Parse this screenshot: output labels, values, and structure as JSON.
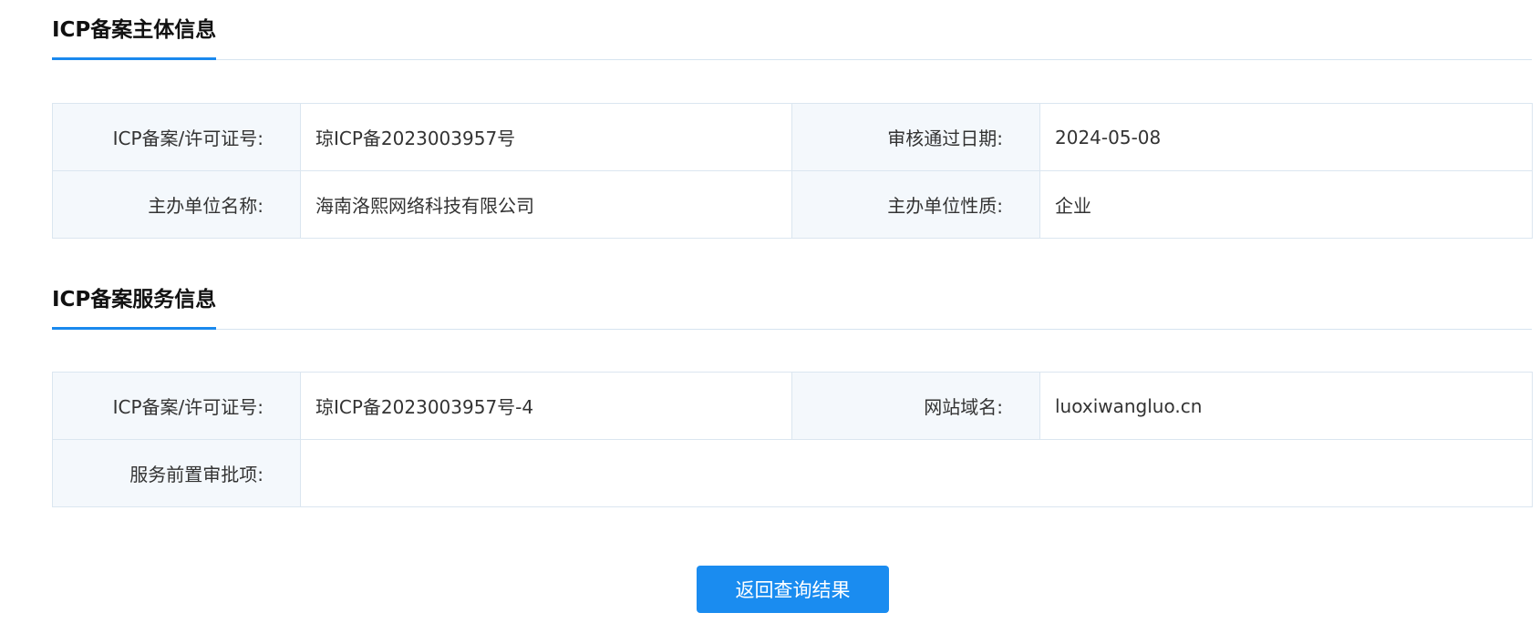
{
  "subject_section": {
    "title": "ICP备案主体信息",
    "rows": [
      {
        "label1": "ICP备案/许可证号:",
        "value1": "琼ICP备2023003957号",
        "label2": "审核通过日期:",
        "value2": "2024-05-08"
      },
      {
        "label1": "主办单位名称:",
        "value1": "海南洛熙网络科技有限公司",
        "label2": "主办单位性质:",
        "value2": "企业"
      }
    ]
  },
  "service_section": {
    "title": "ICP备案服务信息",
    "row1": {
      "label1": "ICP备案/许可证号:",
      "value1": "琼ICP备2023003957号-4",
      "label2": "网站域名:",
      "value2": "luoxiwangluo.cn"
    },
    "row2": {
      "label1": "服务前置审批项:",
      "value1": ""
    }
  },
  "back_button_label": "返回查询结果",
  "colors": {
    "accent": "#1a89ee",
    "button": "#1a8cf0",
    "label_bg": "#f4f8fc",
    "border": "#dbe6f0"
  }
}
